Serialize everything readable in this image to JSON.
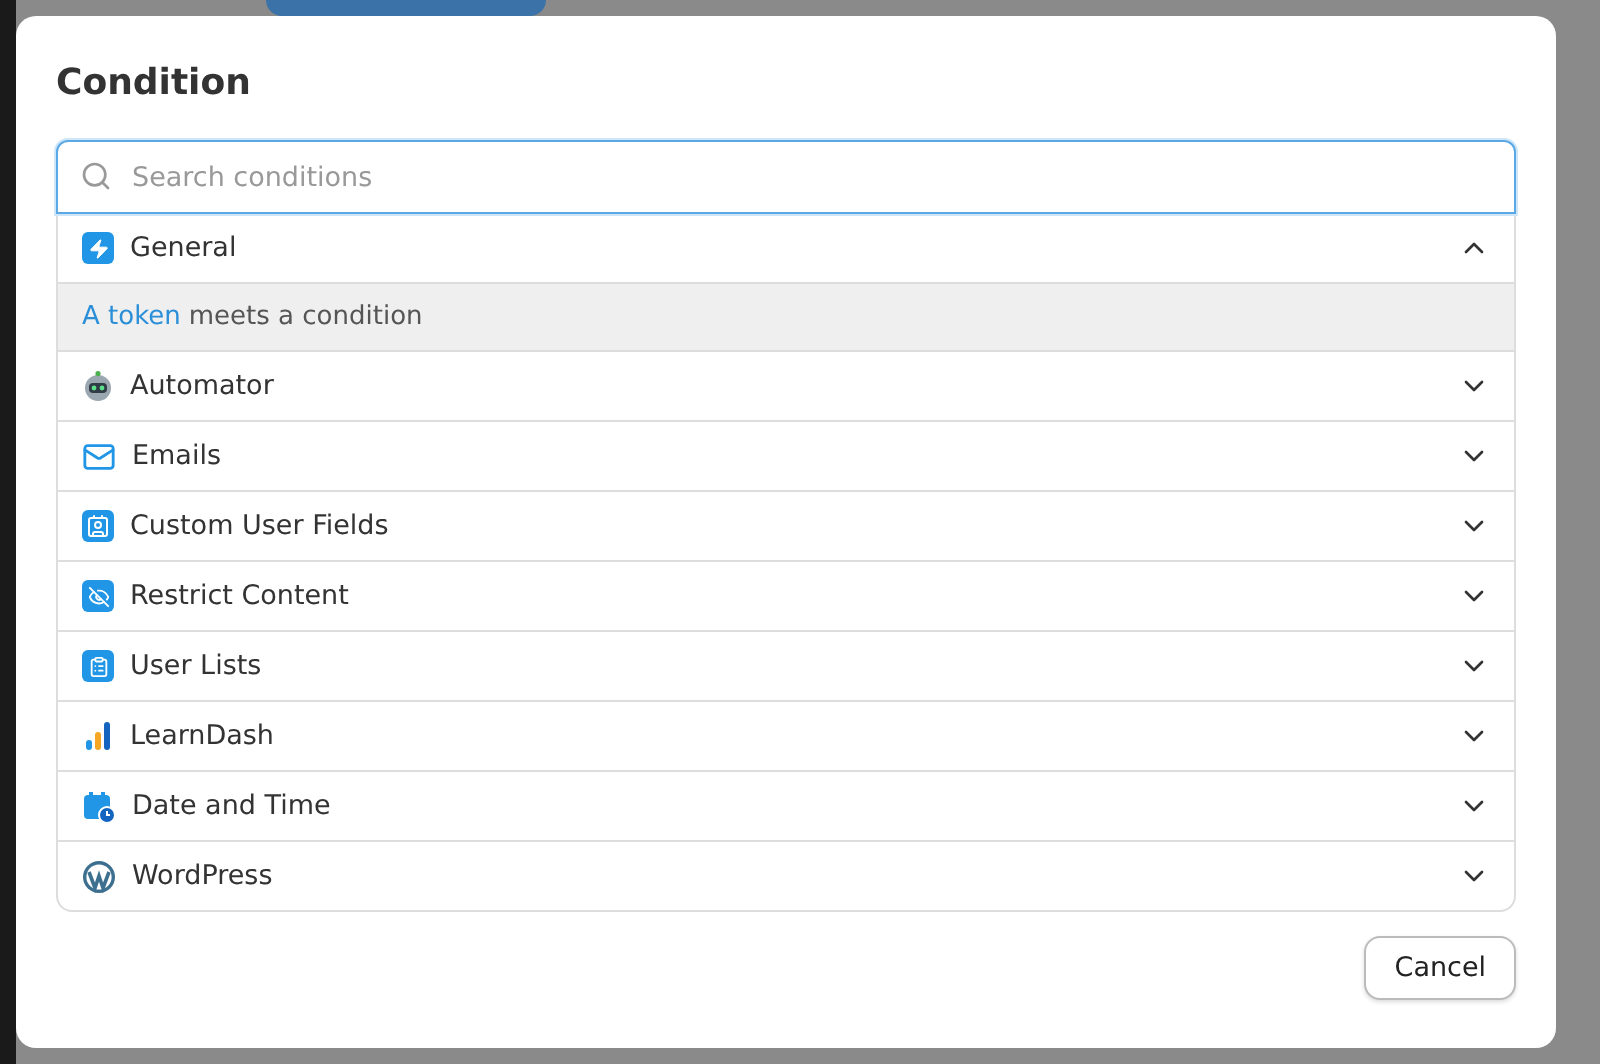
{
  "dialog": {
    "title": "Condition",
    "search": {
      "placeholder": "Search conditions"
    },
    "groups": [
      {
        "label": "General",
        "kind": "bolt",
        "expanded": true,
        "items": [
          {
            "link": "A token",
            "text": "meets a condition"
          }
        ]
      },
      {
        "label": "Automator",
        "kind": "robot",
        "expanded": false
      },
      {
        "label": "Emails",
        "kind": "mail",
        "expanded": false
      },
      {
        "label": "Custom User Fields",
        "kind": "card",
        "expanded": false
      },
      {
        "label": "Restrict Content",
        "kind": "eye-off",
        "expanded": false
      },
      {
        "label": "User Lists",
        "kind": "clipboard",
        "expanded": false
      },
      {
        "label": "LearnDash",
        "kind": "bars",
        "expanded": false
      },
      {
        "label": "Date and Time",
        "kind": "calendar",
        "expanded": false
      },
      {
        "label": "WordPress",
        "kind": "wordpress",
        "expanded": false
      }
    ],
    "buttons": [
      {
        "label": "Cancel"
      }
    ]
  }
}
